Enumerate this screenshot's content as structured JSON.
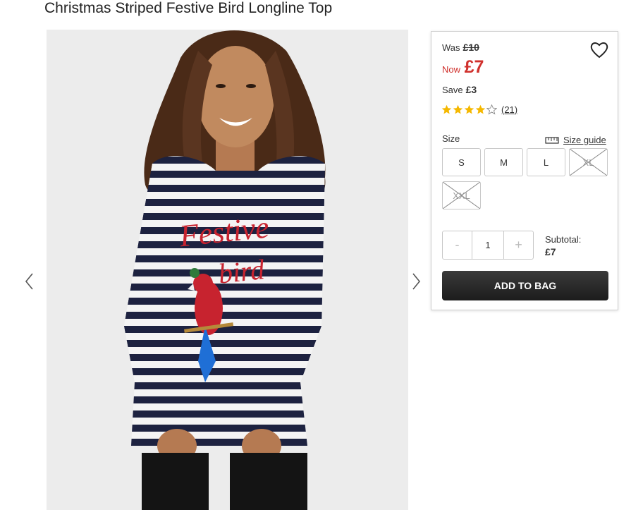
{
  "product": {
    "title": "Christmas Striped Festive Bird Longline Top"
  },
  "gallery": {
    "image_text_line1": "Festive",
    "image_text_line2": "bird",
    "prev_icon": "chevron-left-icon",
    "next_icon": "chevron-right-icon"
  },
  "price": {
    "was_label": "Was",
    "was_amount": "£10",
    "now_label": "Now",
    "now_amount": "£7",
    "save_label": "Save",
    "save_amount": "£3",
    "accent_color": "#d0312d"
  },
  "wishlist": {
    "icon": "heart-icon"
  },
  "rating": {
    "stars": 4,
    "max": 5,
    "count_text": "(21)",
    "star_color": "#f5b800"
  },
  "size": {
    "label": "Size",
    "guide_label": "Size guide",
    "guide_icon": "ruler-icon",
    "options": [
      {
        "label": "S",
        "available": true
      },
      {
        "label": "M",
        "available": true
      },
      {
        "label": "L",
        "available": true
      },
      {
        "label": "XL",
        "available": false
      },
      {
        "label": "XXL",
        "available": false
      }
    ]
  },
  "quantity": {
    "minus": "-",
    "value": "1",
    "plus": "+"
  },
  "subtotal": {
    "label": "Subtotal:",
    "value": "£7"
  },
  "cart": {
    "add_label": "ADD TO BAG"
  }
}
